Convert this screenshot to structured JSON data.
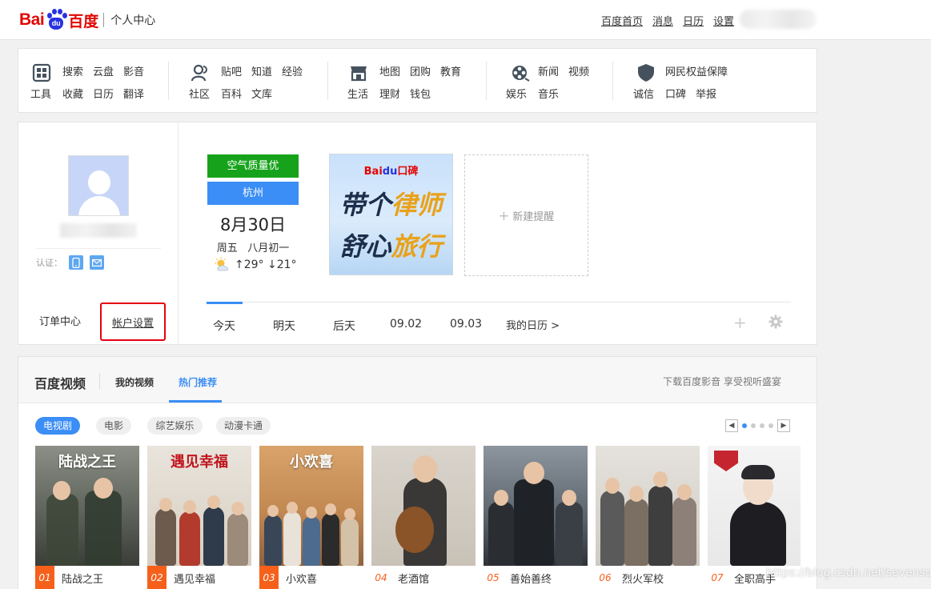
{
  "header": {
    "logo_bai": "Bai",
    "logo_du": "du",
    "logo_baidu": "百度",
    "subtitle": "个人中心",
    "links": [
      "百度首页",
      "消息",
      "日历",
      "设置"
    ]
  },
  "nav": {
    "groups": [
      {
        "icon": "tools-icon",
        "label": "工具",
        "links": [
          [
            "搜索",
            "云盘",
            "影音"
          ],
          [
            "收藏",
            "日历",
            "翻译"
          ]
        ]
      },
      {
        "icon": "community-icon",
        "label": "社区",
        "links": [
          [
            "贴吧",
            "知道",
            "经验"
          ],
          [
            "百科",
            "文库"
          ]
        ]
      },
      {
        "icon": "store-icon",
        "label": "生活",
        "links": [
          [
            "地图",
            "团购",
            "教育"
          ],
          [
            "理财",
            "钱包"
          ]
        ]
      },
      {
        "icon": "film-reel-icon",
        "label": "娱乐",
        "links": [
          [
            "新闻",
            "视频"
          ],
          [
            "音乐"
          ]
        ]
      },
      {
        "icon": "shield-icon",
        "label": "诚信",
        "links": [
          [
            "网民权益保障"
          ],
          [
            "口碑",
            "举报"
          ]
        ]
      }
    ]
  },
  "profile": {
    "verify_label": "认证：",
    "order_center": "订单中心",
    "account_settings": "帐户设置"
  },
  "calendar": {
    "air_quality": "空气质量优",
    "city": "杭州",
    "date": "8月30日",
    "weekday": "周五",
    "lunar": "八月初一",
    "high": "↑29°",
    "low": "↓21°",
    "promo_logo": "Baidu口碑",
    "promo_line1_a": "带个",
    "promo_line1_b": "律师",
    "promo_line2_a": "舒心",
    "promo_line2_b": "旅行",
    "new_reminder": "新建提醒",
    "day_tabs": [
      "今天",
      "明天",
      "后天",
      "09.02",
      "09.03",
      "我的日历 >"
    ]
  },
  "video": {
    "title": "百度视频",
    "tab_mine": "我的视频",
    "tab_hot": "热门推荐",
    "right_text": "下载百度影音 享受视听盛宴",
    "categories": [
      "电视剧",
      "电影",
      "综艺娱乐",
      "动漫卡通"
    ],
    "items": [
      {
        "num": "01",
        "title": "陆战之王",
        "poster_text": "陆战之王"
      },
      {
        "num": "02",
        "title": "遇见幸福",
        "poster_text": "遇见幸福"
      },
      {
        "num": "03",
        "title": "小欢喜",
        "poster_text": "小欢喜"
      },
      {
        "num": "04",
        "title": "老酒馆",
        "poster_text": ""
      },
      {
        "num": "05",
        "title": "善始善终",
        "poster_text": ""
      },
      {
        "num": "06",
        "title": "烈火军校",
        "poster_text": ""
      },
      {
        "num": "07",
        "title": "全职高手",
        "poster_text": ""
      }
    ]
  },
  "watermark": "https://blog.csdn.net/sevensolo",
  "colors": {
    "brand_red": "#e10602",
    "brand_blue": "#2932e1",
    "accent": "#3b8ef5",
    "air_green": "#16a31b",
    "rank_orange": "#f6601b"
  }
}
